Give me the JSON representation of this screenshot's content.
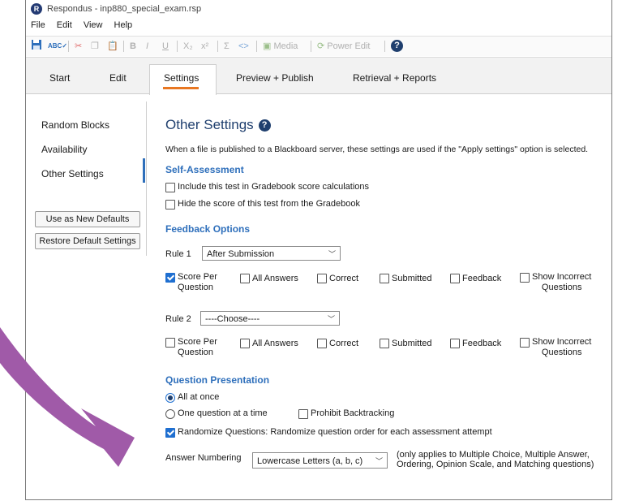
{
  "window": {
    "title": "Respondus - inp880_special_exam.rsp",
    "app_icon": "R"
  },
  "menu": [
    "File",
    "Edit",
    "View",
    "Help"
  ],
  "toolbar": {
    "media": "Media",
    "power_edit": "Power Edit",
    "bold": "B",
    "italic": "I",
    "underline": "U",
    "sub": "X₂",
    "sup": "x²",
    "sigma": "Σ",
    "code": "<>"
  },
  "tabs": {
    "start": "Start",
    "edit": "Edit",
    "settings": "Settings",
    "preview": "Preview + Publish",
    "retrieval": "Retrieval + Reports"
  },
  "sidebar": {
    "items": [
      "Random Blocks",
      "Availability",
      "Other Settings"
    ],
    "use_defaults": "Use as New Defaults",
    "restore_defaults": "Restore Default Settings"
  },
  "main": {
    "heading": "Other Settings",
    "intro": "When a file is published to a Blackboard server, these settings are used if the \"Apply settings\" option is selected.",
    "self_assessment": {
      "title": "Self-Assessment",
      "include": "Include this test in Gradebook score calculations",
      "hide": "Hide the score of this test from the  Gradebook"
    },
    "feedback": {
      "title": "Feedback Options",
      "rule1_label": "Rule 1",
      "rule1_value": "After Submission",
      "rule2_label": "Rule 2",
      "rule2_value": "----Choose----",
      "score_per_1": "Score Per",
      "score_per_2": "Question",
      "all_answers": "All Answers",
      "correct": "Correct",
      "submitted": "Submitted",
      "feedback": "Feedback",
      "show_incorrect_1": "Show Incorrect",
      "show_incorrect_2": "Questions"
    },
    "presentation": {
      "title": "Question Presentation",
      "all_at_once": "All at once",
      "one_at_a_time": "One question at a time",
      "prohibit_backtracking": "Prohibit Backtracking",
      "randomize": "Randomize Questions:  Randomize question order for each assessment attempt",
      "numbering_label": "Answer Numbering",
      "numbering_value": "Lowercase Letters (a, b, c)",
      "numbering_note_1": "(only applies to Multiple Choice, Multiple Answer,",
      "numbering_note_2": "Ordering, Opinion Scale, and Matching questions)"
    }
  },
  "colors": {
    "accent": "#2e6fbb",
    "heading": "#1f3f6e",
    "tab_underline": "#e87722",
    "arrow": "#a05aa8"
  }
}
